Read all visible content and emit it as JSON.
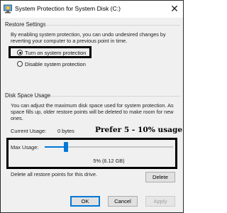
{
  "window": {
    "title": "System Protection for System Disk (C:)",
    "close_glyph": "✕"
  },
  "restore_settings": {
    "title": "Restore Settings",
    "description": "By enabling system protection, you can undo undesired changes by reverting your computer to a previous point in time.",
    "options": [
      {
        "label": "Turn on system protection",
        "selected": true
      },
      {
        "label": "Disable system protection",
        "selected": false
      }
    ]
  },
  "disk_space": {
    "title": "Disk Space Usage",
    "description": "You can adjust the maximum disk space used for system protection. As space fills up, older restore points will be deleted to make room for new ones.",
    "current_usage_label": "Current Usage:",
    "current_usage_value": "0 bytes",
    "annotation": "Prefer 5 - 10% usage",
    "max_usage_label": "Max Usage:",
    "max_usage_value": "5% (6.12 GB)",
    "max_usage_fraction": 0.05,
    "delete_text": "Delete all restore points for this drive.",
    "delete_button": "Delete"
  },
  "buttons": {
    "ok": "OK",
    "cancel": "Cancel",
    "apply": "Apply"
  },
  "colors": {
    "accent": "#0078d7",
    "annotation_box": "#000000"
  },
  "icons": {
    "window": "shield-computer-icon"
  }
}
